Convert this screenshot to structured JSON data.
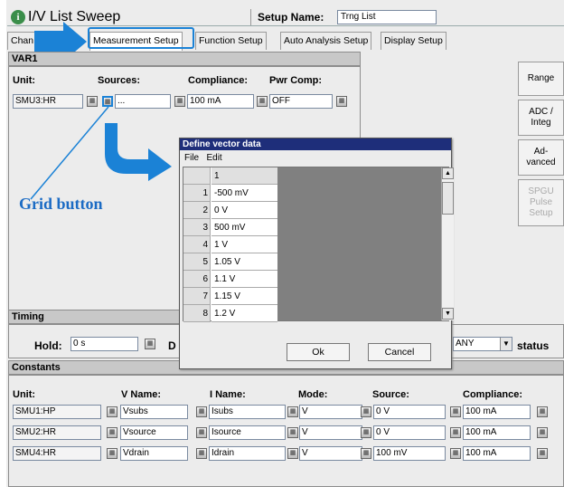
{
  "window": {
    "title": "I/V List Sweep",
    "setup_name_label": "Setup Name:",
    "setup_name_value": "Trng List"
  },
  "tabs": [
    "Chan",
    "Measurement Setup",
    "Function Setup",
    "Auto Analysis Setup",
    "Display Setup"
  ],
  "var1": {
    "header": "VAR1",
    "col_unit": "Unit:",
    "col_sources": "Sources:",
    "col_compliance": "Compliance:",
    "col_pwr": "Pwr Comp:",
    "unit": "SMU3:HR",
    "source": "...",
    "compliance": "100 mA",
    "pwr": "OFF"
  },
  "side_buttons": [
    "Range",
    "ADC / Integ",
    "Ad-vanced",
    "SPGU Pulse Setup"
  ],
  "annotation": {
    "label": "Grid button",
    "color": "#1b82d6"
  },
  "dialog": {
    "title": "Define vector data",
    "menu": [
      "File",
      "Edit"
    ],
    "col_header": "1",
    "rows": [
      {
        "n": "1",
        "v": "-500 mV"
      },
      {
        "n": "2",
        "v": "0 V"
      },
      {
        "n": "3",
        "v": "500 mV"
      },
      {
        "n": "4",
        "v": "1 V"
      },
      {
        "n": "5",
        "v": "1.05 V"
      },
      {
        "n": "6",
        "v": "1.1 V"
      },
      {
        "n": "7",
        "v": "1.15 V"
      },
      {
        "n": "8",
        "v": "1.2 V"
      }
    ],
    "ok": "Ok",
    "cancel": "Cancel"
  },
  "timing": {
    "header": "Timing",
    "hold_label": "Hold:",
    "hold_value": "0 s",
    "d_label": "D",
    "status_value": "ANY",
    "status_label": "status"
  },
  "constants": {
    "header": "Constants",
    "cols": [
      "Unit:",
      "V Name:",
      "I Name:",
      "Mode:",
      "Source:",
      "Compliance:"
    ],
    "rows": [
      {
        "unit": "SMU1:HP",
        "vname": "Vsubs",
        "iname": "Isubs",
        "mode": "V",
        "source": "0 V",
        "compliance": "100 mA"
      },
      {
        "unit": "SMU2:HR",
        "vname": "Vsource",
        "iname": "Isource",
        "mode": "V",
        "source": "0 V",
        "compliance": "100 mA"
      },
      {
        "unit": "SMU4:HR",
        "vname": "Vdrain",
        "iname": "Idrain",
        "mode": "V",
        "source": "100 mV",
        "compliance": "100 mA"
      }
    ]
  }
}
